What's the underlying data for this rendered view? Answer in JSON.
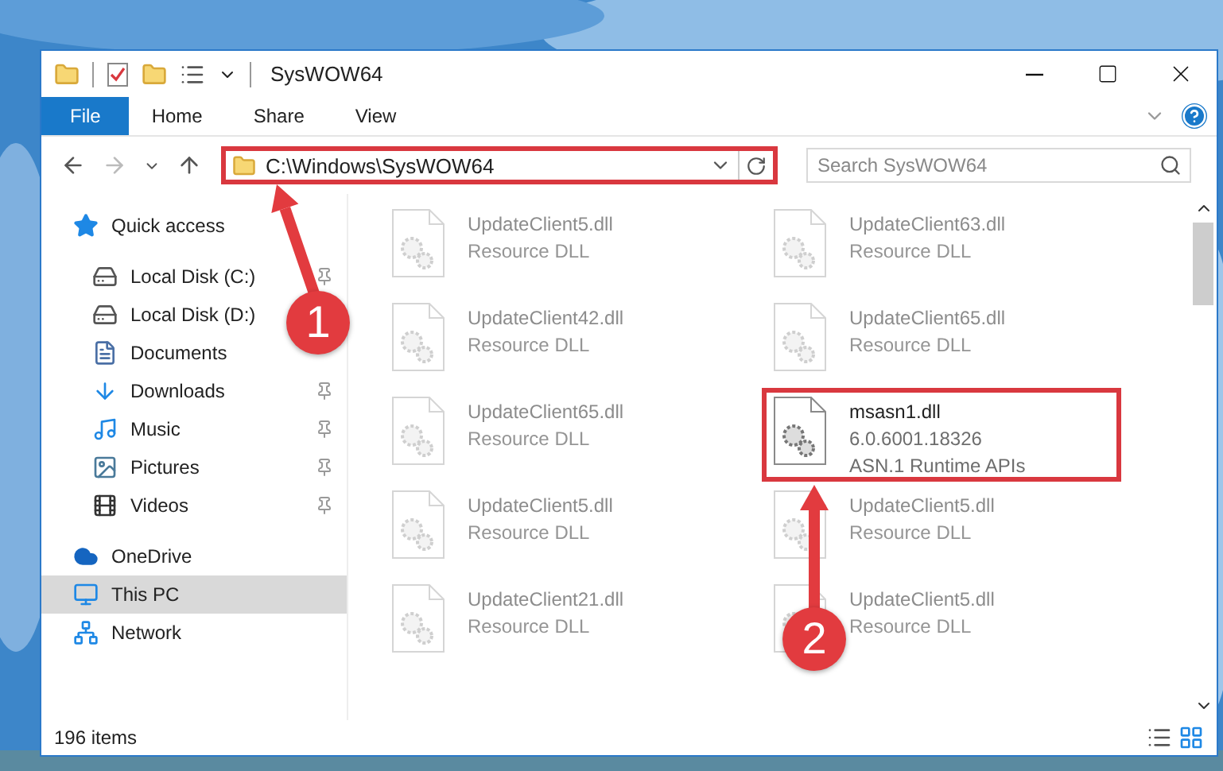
{
  "window": {
    "title": "SysWOW64"
  },
  "ribbon_tabs": [
    {
      "label": "File",
      "kind": "file"
    },
    {
      "label": "Home",
      "kind": "tab"
    },
    {
      "label": "Share",
      "kind": "tab"
    },
    {
      "label": "View",
      "kind": "tab"
    }
  ],
  "address_bar": {
    "path": "C:\\Windows\\SysWOW64",
    "highlighted": true
  },
  "search": {
    "placeholder": "Search SysWOW64"
  },
  "sidebar": {
    "items": [
      {
        "label": "Quick access",
        "kind": "star",
        "selected": false,
        "children": [
          {
            "label": "Local Disk (C:)",
            "kind": "system-drive",
            "pinned": true,
            "selected": false
          },
          {
            "label": "Local Disk (D:)",
            "kind": "drive",
            "pinned": false,
            "selected": false
          },
          {
            "label": "Documents",
            "kind": "documents",
            "pinned": false,
            "selected": false
          },
          {
            "label": "Downloads",
            "kind": "downloads",
            "pinned": true,
            "selected": false
          },
          {
            "label": "Music",
            "kind": "music",
            "pinned": true,
            "selected": false
          },
          {
            "label": "Pictures",
            "kind": "pictures",
            "pinned": true,
            "selected": false
          },
          {
            "label": "Videos",
            "kind": "videos",
            "pinned": true,
            "selected": false
          }
        ]
      },
      {
        "label": "OneDrive",
        "kind": "cloud",
        "selected": false
      },
      {
        "label": "This PC",
        "kind": "computer",
        "selected": true
      },
      {
        "label": "Network",
        "kind": "network",
        "selected": false
      }
    ]
  },
  "files": [
    {
      "name": "UpdateClient5.dll",
      "details": [
        "Resource DLL"
      ],
      "faded": true,
      "highlighted": false
    },
    {
      "name": "UpdateClient63.dll",
      "details": [
        "Resource DLL"
      ],
      "faded": true,
      "highlighted": false
    },
    {
      "name": "UpdateClient42.dll",
      "details": [
        "Resource DLL"
      ],
      "faded": true,
      "highlighted": false
    },
    {
      "name": "UpdateClient65.dll",
      "details": [
        "Resource DLL"
      ],
      "faded": true,
      "highlighted": false
    },
    {
      "name": "UpdateClient65.dll",
      "details": [
        "Resource DLL"
      ],
      "faded": true,
      "highlighted": false
    },
    {
      "name": "msasn1.dll",
      "details": [
        "6.0.6001.18326",
        "ASN.1 Runtime APIs"
      ],
      "faded": false,
      "highlighted": true
    },
    {
      "name": "UpdateClient5.dll",
      "details": [
        "Resource DLL"
      ],
      "faded": true,
      "highlighted": false
    },
    {
      "name": "UpdateClient5.dll",
      "details": [
        "Resource DLL"
      ],
      "faded": true,
      "highlighted": false
    },
    {
      "name": "UpdateClient21.dll",
      "details": [
        "Resource DLL"
      ],
      "faded": true,
      "highlighted": false
    },
    {
      "name": "UpdateClient5.dll",
      "details": [
        "Resource DLL"
      ],
      "faded": true,
      "highlighted": false
    }
  ],
  "status_bar": {
    "item_count": "196 items"
  },
  "annotations": [
    {
      "number": "1"
    },
    {
      "number": "2"
    }
  ]
}
